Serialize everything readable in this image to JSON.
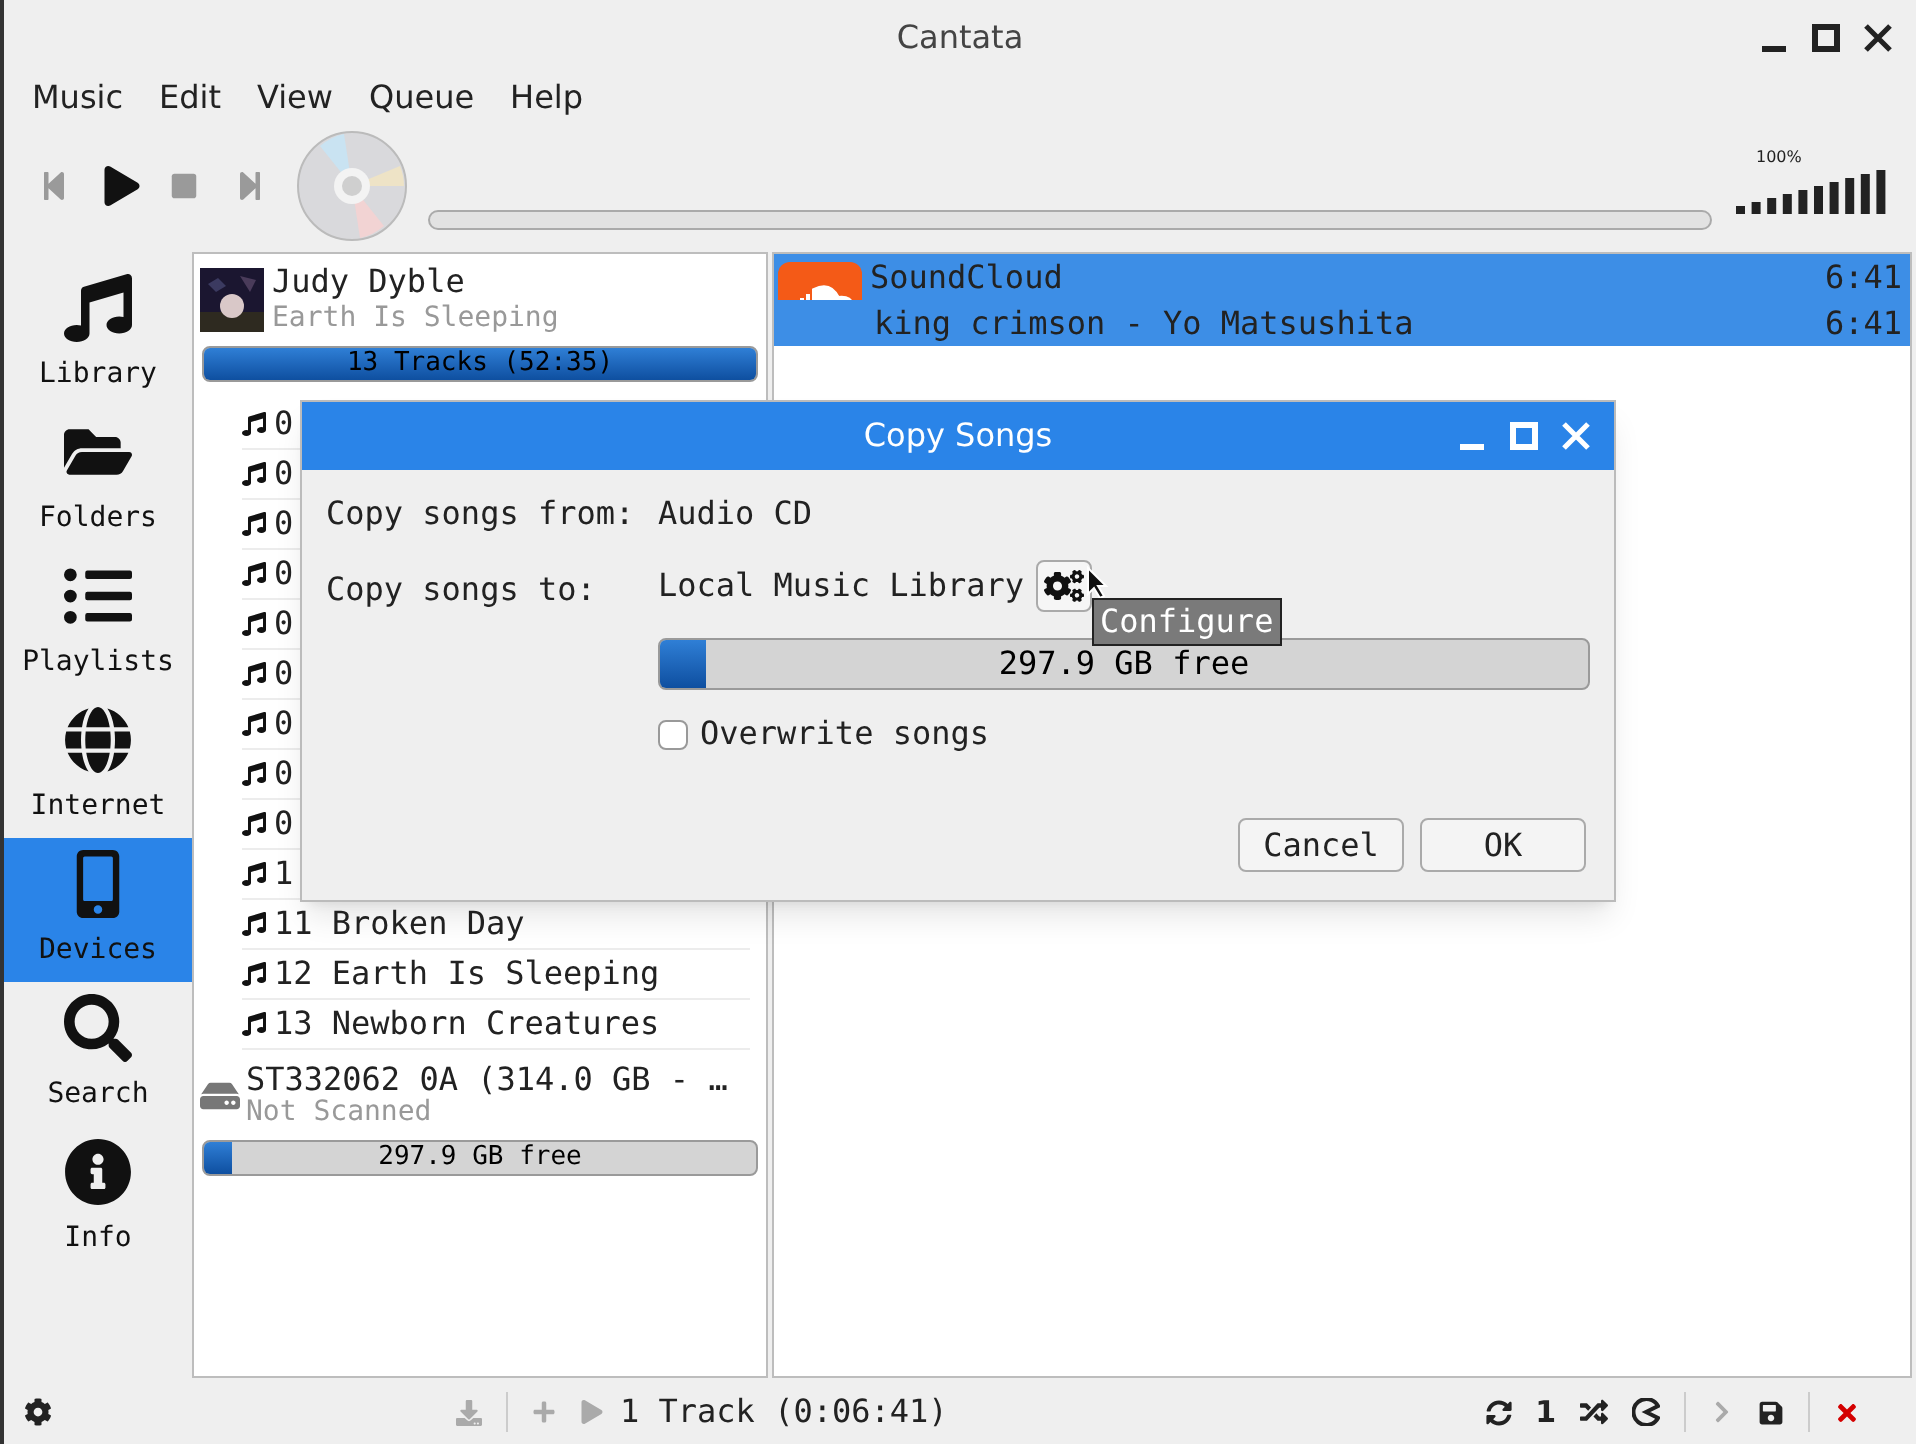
{
  "window": {
    "title": "Cantata"
  },
  "menu": [
    "Music",
    "Edit",
    "View",
    "Queue",
    "Help"
  ],
  "volume": {
    "reading": "100%"
  },
  "sidebar": {
    "items": [
      {
        "label": "Library",
        "selected": false
      },
      {
        "label": "Folders",
        "selected": false
      },
      {
        "label": "Playlists",
        "selected": false
      },
      {
        "label": "Internet",
        "selected": false
      },
      {
        "label": "Devices",
        "selected": true
      },
      {
        "label": "Search",
        "selected": false
      },
      {
        "label": "Info",
        "selected": false
      }
    ]
  },
  "devices": [
    {
      "kind": "album",
      "title": "Judy Dyble",
      "subtitle": "Earth Is Sleeping",
      "bar": {
        "text": "13 Tracks (52:35)",
        "level": 1
      },
      "tracks": [
        "0",
        "0",
        "0",
        "0",
        "0",
        "0",
        "0",
        "0",
        "0",
        "1",
        "11 Broken Day",
        "12 Earth Is Sleeping",
        "13 Newborn Creatures"
      ]
    },
    {
      "kind": "drive",
      "title": "ST332062 0A (314.0 GB - …",
      "subtitle": "Not Scanned",
      "bar": {
        "text": "297.9 GB free",
        "level": 0.05
      }
    }
  ],
  "queue": [
    {
      "kind": "header",
      "text": "SoundCloud",
      "time": "6:41",
      "selected": true
    },
    {
      "kind": "track",
      "text": "king crimson - Yo Matsushita",
      "time": "6:41",
      "selected": true
    }
  ],
  "status_bar": {
    "summary": "1 Track (0:06:41)",
    "single": "1"
  },
  "dialog": {
    "title": "Copy Songs",
    "from_label": "Copy songs from:",
    "from_value": "Audio CD",
    "to_label": "Copy songs to:",
    "to_value": "Local Music Library",
    "space": {
      "text": "297.9 GB free",
      "level": 0.05
    },
    "overwrite": {
      "label": "Overwrite songs",
      "checked": false
    },
    "tooltip": "Configure",
    "buttons": [
      "Cancel",
      "OK"
    ]
  }
}
